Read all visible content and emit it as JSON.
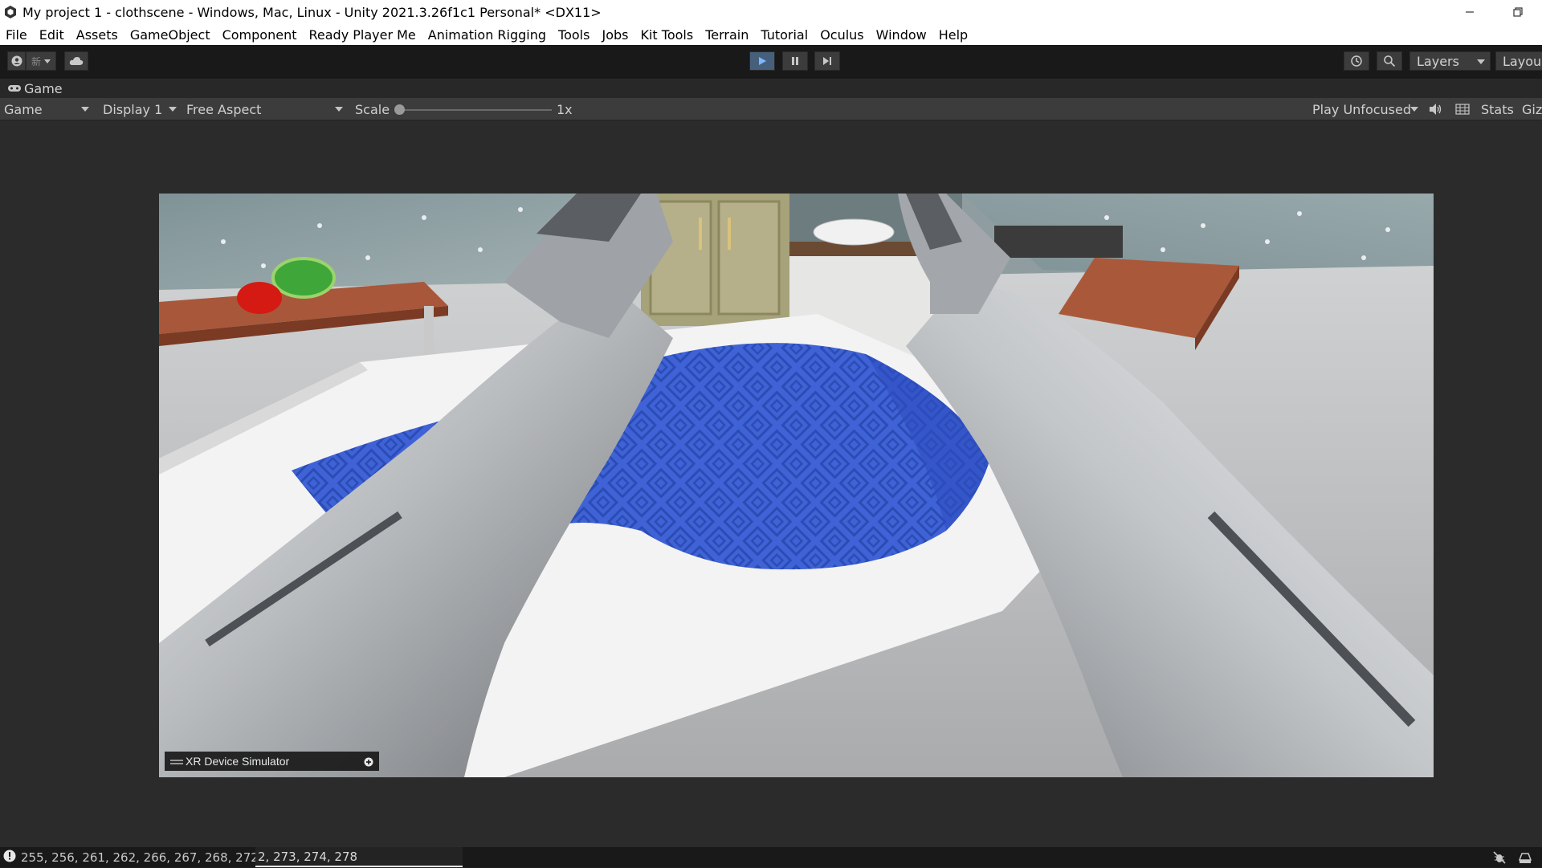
{
  "window": {
    "title": "My project 1 - clothscene - Windows, Mac, Linux - Unity 2021.3.26f1c1 Personal* <DX11>"
  },
  "menu": [
    "File",
    "Edit",
    "Assets",
    "GameObject",
    "Component",
    "Ready Player Me",
    "Animation Rigging",
    "Tools",
    "Jobs",
    "Kit Tools",
    "Terrain",
    "Tutorial",
    "Oculus",
    "Window",
    "Help"
  ],
  "toolbar": {
    "layers_label": "Layers",
    "layout_label": "Layou"
  },
  "game_tab": {
    "label": "Game"
  },
  "game_toolbar": {
    "view_mode": "Game",
    "display": "Display 1",
    "aspect": "Free Aspect",
    "scale_label": "Scale",
    "scale_value": "1x",
    "play_mode": "Play Unfocused",
    "stats_label": "Stats",
    "gizmos_label": "Giz"
  },
  "xr_simulator": {
    "label": "XR Device Simulator"
  },
  "statusbar": {
    "message": "255, 256, 261, 262, 266, 267, 268, 272, 2",
    "overlay": "2, 273, 274, 278"
  },
  "colors": {
    "cloth": "#3a5fd0",
    "play_active": "#46607c",
    "editor_dark": "#191919"
  }
}
